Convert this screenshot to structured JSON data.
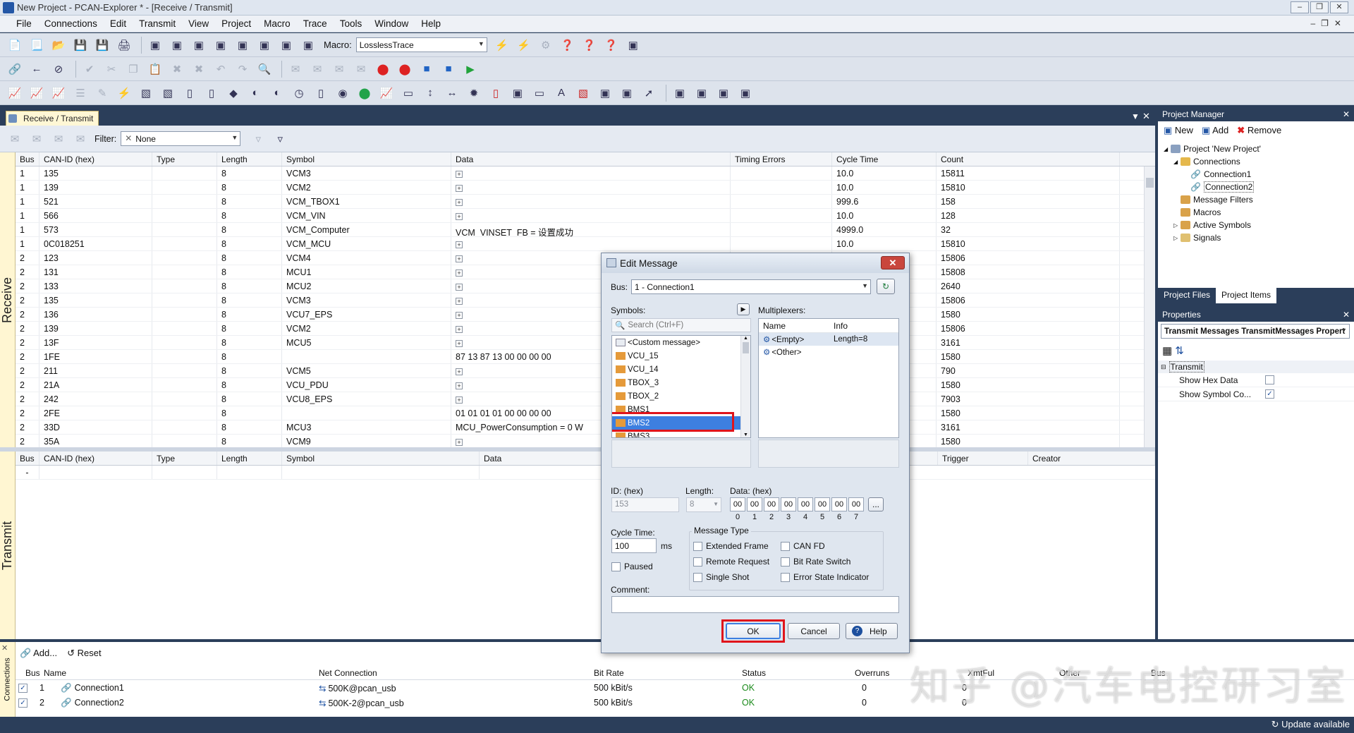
{
  "window": {
    "title": "New Project - PCAN-Explorer * - [Receive / Transmit]"
  },
  "menu": [
    "File",
    "Connections",
    "Edit",
    "Transmit",
    "View",
    "Project",
    "Macro",
    "Trace",
    "Tools",
    "Window",
    "Help"
  ],
  "toolbar": {
    "macro_label": "Macro:",
    "macro_value": "LosslessTrace"
  },
  "doc_tab": "Receive / Transmit",
  "filter": {
    "label": "Filter:",
    "value": "None"
  },
  "receive": {
    "side_label": "Receive",
    "columns": [
      "Bus",
      "CAN-ID (hex)",
      "Type",
      "Length",
      "Symbol",
      "Data",
      "Timing Errors",
      "Cycle Time",
      "Count"
    ],
    "rows": [
      [
        "1",
        "135",
        "",
        "8",
        "VCM3",
        "+",
        "",
        "10.0",
        "15811"
      ],
      [
        "1",
        "139",
        "",
        "8",
        "VCM2",
        "+",
        "",
        "10.0",
        "15810"
      ],
      [
        "1",
        "521",
        "",
        "8",
        "VCM_TBOX1",
        "+",
        "",
        "999.6",
        "158"
      ],
      [
        "1",
        "566",
        "",
        "8",
        "VCM_VIN",
        "+",
        "",
        "10.0",
        "128"
      ],
      [
        "1",
        "573",
        "",
        "8",
        "VCM_Computer",
        "VCM_VINSET_FB = 设置成功",
        "",
        "4999.0",
        "32"
      ],
      [
        "1",
        "0C018251",
        "",
        "8",
        "VCM_MCU",
        "+",
        "",
        "10.0",
        "15810"
      ],
      [
        "2",
        "123",
        "",
        "8",
        "VCM4",
        "+",
        "",
        "",
        "15806"
      ],
      [
        "2",
        "131",
        "",
        "8",
        "MCU1",
        "+",
        "",
        "",
        "15808"
      ],
      [
        "2",
        "133",
        "",
        "8",
        "MCU2",
        "+",
        "",
        "",
        "2640"
      ],
      [
        "2",
        "135",
        "",
        "8",
        "VCM3",
        "+",
        "",
        "",
        "15806"
      ],
      [
        "2",
        "136",
        "",
        "8",
        "VCU7_EPS",
        "+",
        "",
        "",
        "1580"
      ],
      [
        "2",
        "139",
        "",
        "8",
        "VCM2",
        "+",
        "",
        "",
        "15806"
      ],
      [
        "2",
        "13F",
        "",
        "8",
        "MCU5",
        "+",
        "",
        "",
        "3161"
      ],
      [
        "2",
        "1FE",
        "",
        "8",
        "",
        "87 13 87 13 00 00 00 00",
        "",
        "",
        "1580"
      ],
      [
        "2",
        "211",
        "",
        "8",
        "VCM5",
        "+",
        "",
        "",
        "790"
      ],
      [
        "2",
        "21A",
        "",
        "8",
        "VCU_PDU",
        "+",
        "",
        "",
        "1580"
      ],
      [
        "2",
        "242",
        "",
        "8",
        "VCU8_EPS",
        "+",
        "",
        "",
        "7903"
      ],
      [
        "2",
        "2FE",
        "",
        "8",
        "",
        "01 01 01 01 00 00 00 00",
        "",
        "",
        "1580"
      ],
      [
        "2",
        "33D",
        "",
        "8",
        "MCU3",
        "MCU_PowerConsumption = 0 W",
        "",
        "",
        "3161"
      ],
      [
        "2",
        "35A",
        "",
        "8",
        "VCM9",
        "+",
        "",
        "",
        "1580"
      ]
    ]
  },
  "transmit": {
    "side_label": "Transmit",
    "columns": [
      "Bus",
      "CAN-ID (hex)",
      "Type",
      "Length",
      "Symbol",
      "Data",
      "Trigger",
      "Creator"
    ],
    "row": [
      "-"
    ]
  },
  "project_manager": {
    "title": "Project Manager",
    "new": "New",
    "add": "Add",
    "remove": "Remove",
    "tree": [
      "Project 'New Project'",
      "Connections",
      "Connection1",
      "Connection2",
      "Message Filters",
      "Macros",
      "Active Symbols",
      "Signals"
    ],
    "tab_files": "Project Files",
    "tab_items": "Project Items"
  },
  "properties": {
    "title": "Properties",
    "selector": "Transmit Messages TransmitMessages Propert",
    "category": "Transmit",
    "rows": [
      {
        "name": "Show Hex Data",
        "checked": false
      },
      {
        "name": "Show Symbol Co...",
        "checked": true
      }
    ]
  },
  "dialog": {
    "title": "Edit Message",
    "bus_label": "Bus:",
    "bus_value": "1 - Connection1",
    "symbols_label": "Symbols:",
    "search_placeholder": "Search (Ctrl+F)",
    "symbols": [
      "<Custom message>",
      "VCU_15",
      "VCU_14",
      "TBOX_3",
      "TBOX_2",
      "BMS1",
      "BMS2",
      "BMS3"
    ],
    "selected_symbol": "BMS2",
    "multiplexers_label": "Multiplexers:",
    "mux_columns": [
      "Name",
      "Info"
    ],
    "mux_rows": [
      [
        "<Empty>",
        "Length=8"
      ],
      [
        "<Other>",
        ""
      ]
    ],
    "id_label": "ID: (hex)",
    "id_value": "153",
    "length_label": "Length:",
    "length_value": "8",
    "data_label": "Data: (hex)",
    "data_bytes": [
      "00",
      "00",
      "00",
      "00",
      "00",
      "00",
      "00",
      "00"
    ],
    "data_index": [
      "0",
      "1",
      "2",
      "3",
      "4",
      "5",
      "6",
      "7"
    ],
    "more_button": "...",
    "cycle_label": "Cycle Time:",
    "cycle_value": "100",
    "cycle_unit": "ms",
    "paused_label": "Paused",
    "message_type_label": "Message Type",
    "types_left": [
      "Extended Frame",
      "Remote Request",
      "Single Shot"
    ],
    "types_right": [
      "CAN FD",
      "Bit Rate Switch",
      "Error State Indicator"
    ],
    "comment_label": "Comment:",
    "ok": "OK",
    "cancel": "Cancel",
    "help": "Help"
  },
  "connections": {
    "side_label": "Connections",
    "add": "Add...",
    "reset": "Reset",
    "columns": [
      "Bus",
      "Name",
      "Net Connection",
      "Bit Rate",
      "Status",
      "Overruns",
      "XmtFul",
      "Other",
      "Bus"
    ],
    "rows": [
      [
        "1",
        "Connection1",
        "500K@pcan_usb",
        "500 kBit/s",
        "OK",
        "0",
        "0"
      ],
      [
        "2",
        "Connection2",
        "500K-2@pcan_usb",
        "500 kBit/s",
        "OK",
        "0",
        "0"
      ]
    ]
  },
  "status": {
    "update": "Update available"
  },
  "watermark": "知乎 @汽车电控研习室",
  "colors": {
    "selection": "#3d7fe0",
    "highlight": "#e0141b",
    "status_ok": "#1a8a1a"
  }
}
